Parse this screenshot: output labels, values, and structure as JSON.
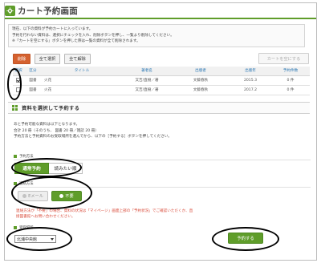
{
  "page": {
    "title": "カート予約画面"
  },
  "info": {
    "lines": [
      "現在、以下の資料が予約カートに入っています。",
      "予約を行わない資料は、選択にチェックを入れ、削除ボタンを押し、一覧より削除してください。",
      "※「カートを空にする」ボタンを押した際は一覧の資料が全て削除されます。"
    ]
  },
  "toolbar": {
    "delete_label": "削除",
    "select_all_label": "全て選択",
    "deselect_all_label": "全て解除",
    "empty_cart_label": "カートを空にする"
  },
  "table": {
    "headers": [
      "選択",
      "区分",
      "タイトル",
      "著者名",
      "出版者",
      "出版年",
      "予約件数"
    ],
    "rows": [
      {
        "checked": true,
        "kind": "図書",
        "title": "火花",
        "author": "又吉/直樹／著",
        "publisher": "文藝春秋",
        "year": "2015.3",
        "count": "0 件"
      },
      {
        "checked": false,
        "kind": "図書",
        "title": "火花",
        "author": "又吉/直樹／著",
        "publisher": "文藝春秋",
        "year": "2017.2",
        "count": "0 件"
      }
    ]
  },
  "section": {
    "title": "資料を選択して予約する"
  },
  "lead": {
    "lines": [
      "あと予約可能な資料は以下となります。",
      "合計 20 冊（そのうち、 図書 20 冊／雑誌 20 冊）",
      "予約方法と予約資料のお受取場所を選んでから、以下の［予約する］ボタンを押してください。"
    ]
  },
  "method": {
    "label": "予約方法",
    "options": [
      "通常予約",
      "読みたい順"
    ]
  },
  "contact": {
    "label": "連絡方法",
    "options": [
      "Eメール",
      "不要"
    ]
  },
  "warning": {
    "lines": [
      "連絡方法が「不要」の場合、資料の状況は「マイページ」画面上部の「予約状況」でご確認いただくか、直",
      "接図書館へお問い合わせください。"
    ]
  },
  "pickup": {
    "label": "受取場所",
    "selected": "北浦中央館"
  },
  "submit_label": "予約する",
  "colors": {
    "accent": "#5f9d2a",
    "danger": "#d5612f",
    "warning_text": "#d94b3a"
  }
}
